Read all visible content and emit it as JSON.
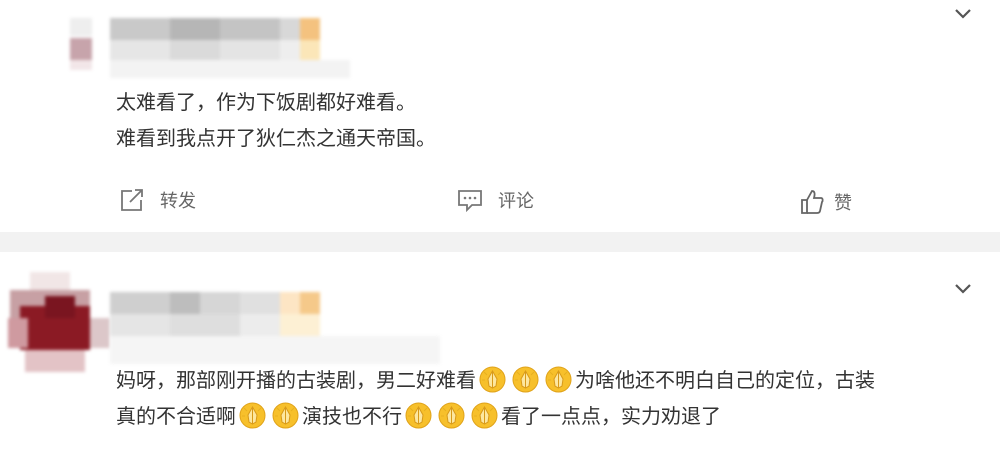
{
  "comments": [
    {
      "text_lines": [
        "太难看了，作为下饭剧都好难看。",
        "难看到我点开了狄仁杰之通天帝国。"
      ],
      "actions": {
        "share": "转发",
        "comment": "评论",
        "like": "赞"
      }
    },
    {
      "segments": [
        {
          "t": "text",
          "v": "妈呀，那部刚开播的古装剧，男二好难看"
        },
        {
          "t": "emoji",
          "v": "pray-emoji"
        },
        {
          "t": "emoji",
          "v": "pray-emoji"
        },
        {
          "t": "emoji",
          "v": "pray-emoji"
        },
        {
          "t": "text",
          "v": "为啥他还不明白自己的定位，古装"
        },
        {
          "t": "br"
        },
        {
          "t": "text",
          "v": "真的不合适啊"
        },
        {
          "t": "emoji",
          "v": "pray-emoji"
        },
        {
          "t": "emoji",
          "v": "pray-emoji"
        },
        {
          "t": "text",
          "v": "演技也不行"
        },
        {
          "t": "emoji",
          "v": "pray-emoji"
        },
        {
          "t": "emoji",
          "v": "pray-emoji"
        },
        {
          "t": "emoji",
          "v": "pray-emoji"
        },
        {
          "t": "text",
          "v": "看了一点点，实力劝退了"
        }
      ]
    }
  ],
  "icons": {
    "chevron": "chevron-down-icon",
    "share": "share-icon",
    "comment": "comment-icon",
    "like": "thumbs-up-icon",
    "emoji": "pray-emoji"
  },
  "colors": {
    "text": "#333333",
    "action_text": "#666666",
    "separator": "#f2f2f2",
    "avatar_red": "#8b1a24",
    "emoji_yellow": "#f7c02b"
  }
}
